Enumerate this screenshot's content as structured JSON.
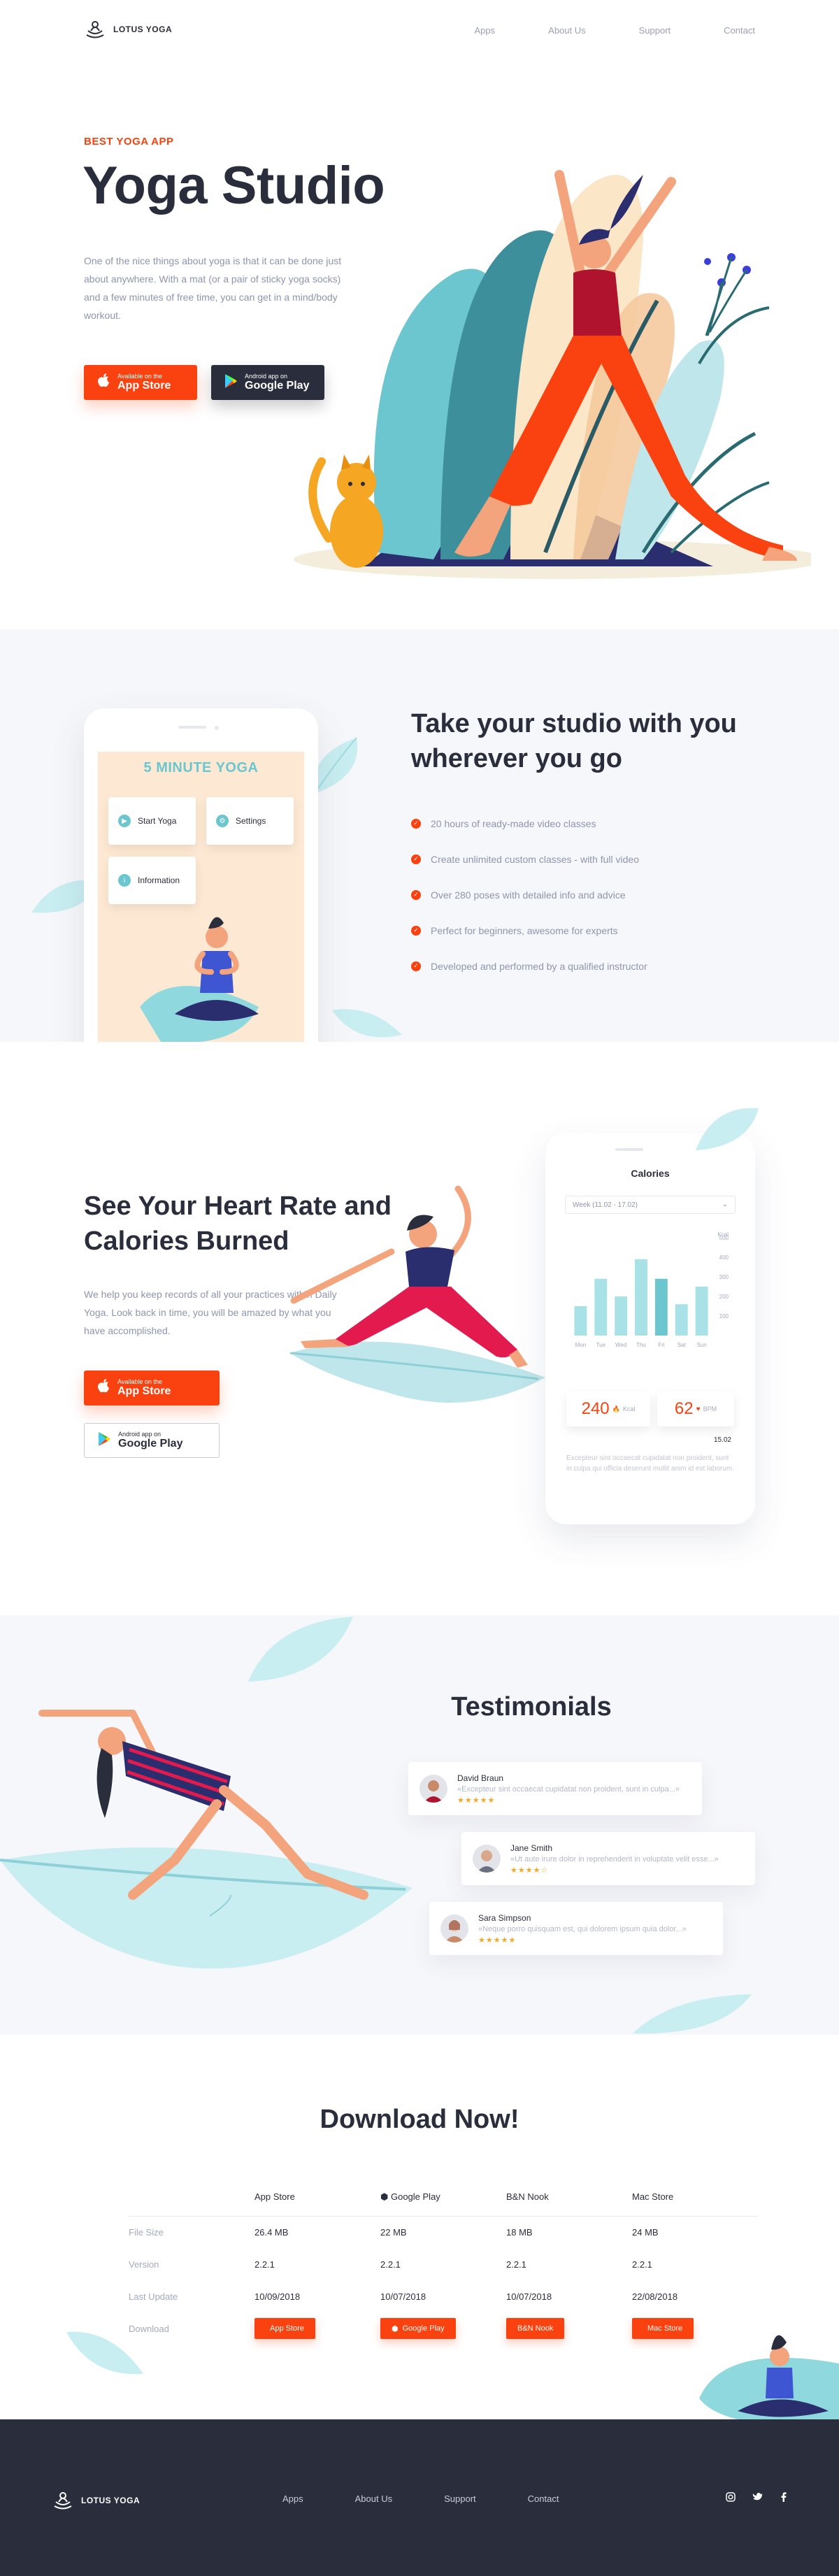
{
  "brand": {
    "name": "LOTUS YOGA",
    "accent": "#f9420f",
    "dark": "#2a2d3c",
    "teal": "#6bc6cf"
  },
  "nav": {
    "items": [
      "Apps",
      "About Us",
      "Support",
      "Contact"
    ]
  },
  "hero": {
    "eyebrow": "BEST YOGA APP",
    "title": "Yoga Studio",
    "body": "One of the nice things about yoga is that it can be done just about anywhere. With a mat (or a pair of sticky yoga socks) and a few minutes of free time, you can get in a mind/body workout.",
    "appstore": {
      "small": "Available on the",
      "big": "App Store"
    },
    "googleplay": {
      "small": "Android app on",
      "big": "Google Play"
    }
  },
  "features": {
    "title": "Take your studio with you wherever you go",
    "bullets": [
      "20 hours of ready-made video classes",
      "Create unlimited custom classes - with full video",
      "Over 280 poses with detailed info and advice",
      "Perfect for beginners,  awesome for experts",
      "Developed and performed by a qualified instructor"
    ],
    "phone": {
      "title": "5 MINUTE YOGA",
      "menu": [
        "Start Yoga",
        "Settings",
        "Information"
      ]
    }
  },
  "heart": {
    "title": "See Your Heart Rate and Calories Burned",
    "body": "We help you keep records of all your practices within Daily Yoga. Look back in time, you will be amazed by what you have accomplished.",
    "appstore": {
      "small": "Available on the",
      "big": "App Store"
    },
    "googleplay": {
      "small": "Android app on",
      "big": "Google Play"
    },
    "phone": {
      "title": "Calories",
      "week": "Week (11.02 - 17.02)",
      "kcal": "240",
      "kcal_unit": "Kcal",
      "bpm": "62",
      "bpm_unit": "BPM",
      "time": "15.02",
      "note": "Excepteur sint occaecat cupidatat non proident, sunt in culpa qui officia deserunt mollit anim id est laborum."
    }
  },
  "chart_data": {
    "type": "bar",
    "categories": [
      "Mon",
      "Tue",
      "Wed",
      "Thu",
      "Fri",
      "Sat",
      "Sun"
    ],
    "values": [
      150,
      290,
      200,
      390,
      290,
      160,
      250
    ],
    "ylabel": "Kcal",
    "yticks": [
      "500",
      "400",
      "300",
      "200",
      "100"
    ],
    "ylim": [
      0,
      500
    ]
  },
  "testimonials": {
    "title": "Testimonials",
    "items": [
      {
        "name": "David Braun",
        "quote": "«Excepteur sint occaecat cupidatat non proident, sunt in culpa...»",
        "stars": "★★★★★"
      },
      {
        "name": "Jane Smith",
        "quote": "«Ut aute irure dolor in reprehenderit in voluptate velit esse...»",
        "stars": "★★★★☆"
      },
      {
        "name": "Sara Simpson",
        "quote": "«Neque porro quisquam est, qui dolorem ipsum quia dolor...»",
        "stars": "★★★★★"
      }
    ]
  },
  "download": {
    "title": "Download Now!",
    "columns": [
      "App Store",
      "Google Play",
      "B&N Nook",
      "Mac Store"
    ],
    "rows": [
      {
        "label": "File Size",
        "values": [
          "26.4 MB",
          "22 MB",
          "18 MB",
          "24 MB"
        ]
      },
      {
        "label": "Version",
        "values": [
          "2.2.1",
          "2.2.1",
          "2.2.1",
          "2.2.1"
        ]
      },
      {
        "label": "Last Update",
        "values": [
          "10/09/2018",
          "10/07/2018",
          "10/07/2018",
          "22/08/2018"
        ]
      }
    ],
    "download_label": "Download",
    "buttons": [
      "App Store",
      "Google Play",
      "B&N Nook",
      "Mac Store"
    ]
  },
  "footer": {
    "nav": [
      "Apps",
      "About Us",
      "Support",
      "Contact"
    ],
    "social": [
      "instagram-icon",
      "twitter-icon",
      "facebook-icon"
    ]
  }
}
